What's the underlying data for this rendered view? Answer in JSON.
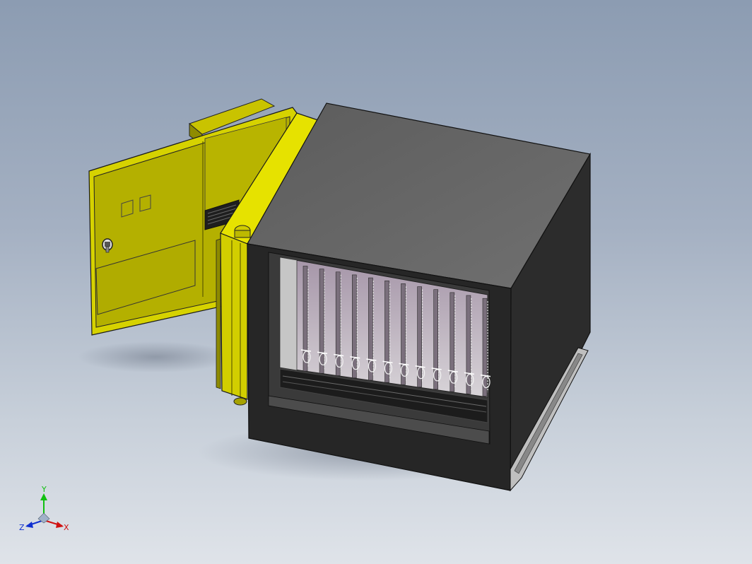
{
  "viewport": {
    "background_top": "#8c9cb2",
    "background_bottom": "#dfe3e9"
  },
  "model": {
    "parts": [
      "housing-box",
      "yellow-door",
      "door-hinge-pillar",
      "card-rack",
      "side-rail"
    ],
    "colors": {
      "door_yellow": "#d8d400",
      "door_face": "#b9b500",
      "housing_dark": "#2b2b2b",
      "housing_top": "#666666",
      "rack_back": "#9b8d9e"
    },
    "card_slot_count": 12
  },
  "triad": {
    "y_label": "Y",
    "z_label": "Z",
    "x_label": "X",
    "colors": {
      "x": "#d01010",
      "y": "#10c010",
      "z": "#1030d0"
    }
  }
}
